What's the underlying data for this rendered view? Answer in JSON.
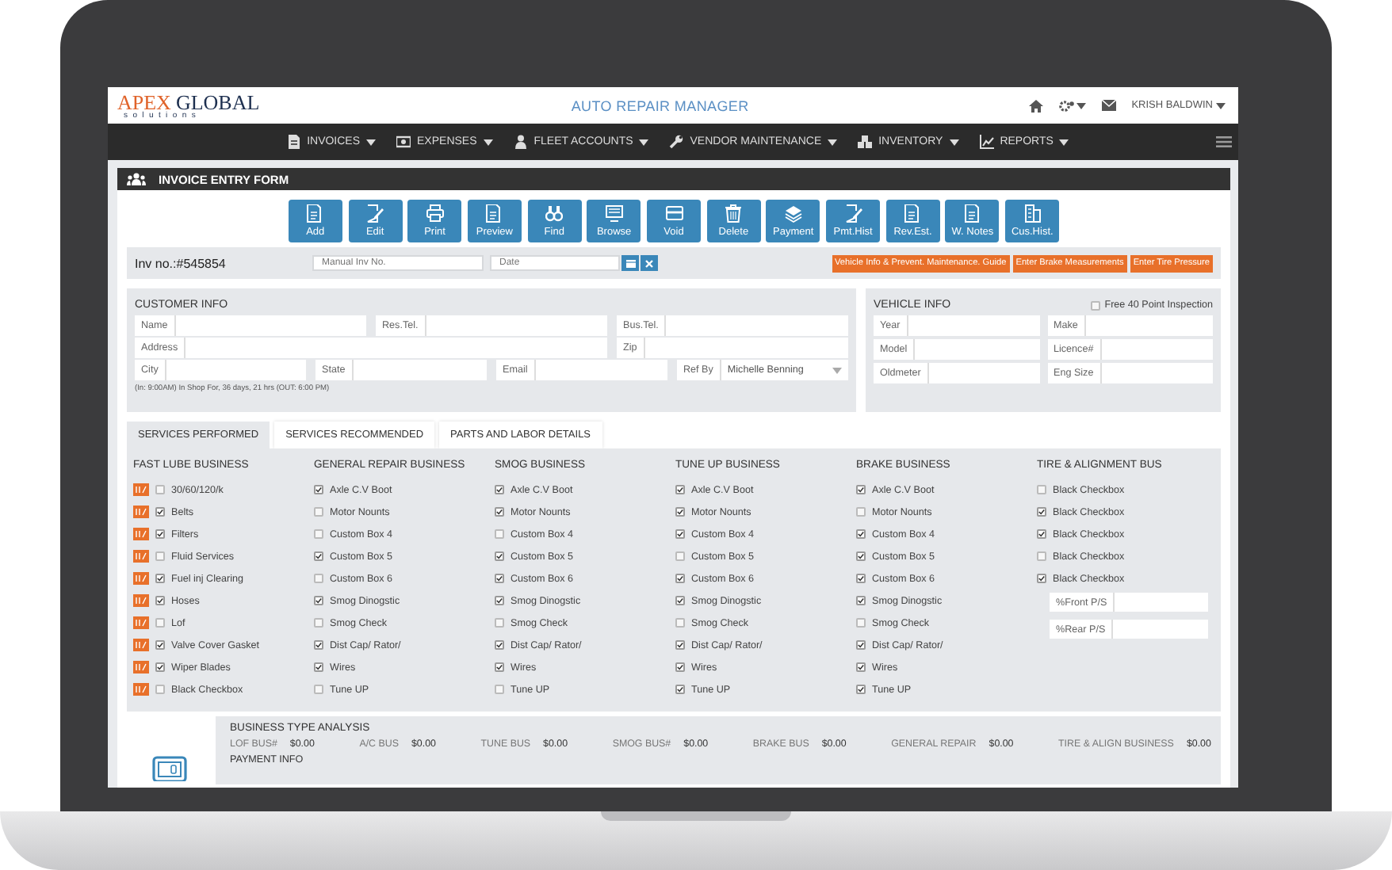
{
  "header": {
    "logo": {
      "brand": "APEX",
      "name": "GLOBAL",
      "tagline": "solutions"
    },
    "title": "AUTO REPAIR MANAGER",
    "user": "KRISH BALDWIN"
  },
  "nav": [
    {
      "label": "INVOICES"
    },
    {
      "label": "EXPENSES"
    },
    {
      "label": "FLEET ACCOUNTS"
    },
    {
      "label": "VENDOR MAINTENANCE"
    },
    {
      "label": "INVENTORY"
    },
    {
      "label": "REPORTS"
    }
  ],
  "form_title": "INVOICE ENTRY FORM",
  "toolbar": [
    {
      "label": "Add"
    },
    {
      "label": "Edit"
    },
    {
      "label": "Print"
    },
    {
      "label": "Preview"
    },
    {
      "label": "Find"
    },
    {
      "label": "Browse"
    },
    {
      "label": "Void"
    },
    {
      "label": "Delete"
    },
    {
      "label": "Payment"
    },
    {
      "label": "Pmt.Hist"
    },
    {
      "label": "Rev.Est."
    },
    {
      "label": "W. Notes"
    },
    {
      "label": "Cus.Hist."
    }
  ],
  "invoice": {
    "number": "Inv no.:#545854",
    "manual_placeholder": "Manual Inv No.",
    "date_placeholder": "Date"
  },
  "guide_buttons": [
    "Vehicle Info & Prevent. Maintenance. Guide",
    "Enter Brake Measurements",
    "Enter Tire Pressure"
  ],
  "customer_info": {
    "title": "CUSTOMER INFO",
    "rows": [
      [
        {
          "label": "Name",
          "kind": "text"
        },
        {
          "label": "Res.Tel.",
          "kind": "text"
        },
        {
          "label": "Bus.Tel.",
          "kind": "text"
        }
      ],
      [
        {
          "label": "Address",
          "kind": "text"
        },
        {
          "label": "Zip",
          "kind": "text"
        }
      ],
      [
        {
          "label": "City",
          "kind": "text"
        },
        {
          "label": "State",
          "kind": "text"
        },
        {
          "label": "Email",
          "kind": "text"
        },
        {
          "label": "Ref By",
          "kind": "select",
          "value": "Michelle Benning"
        }
      ]
    ],
    "note": "(In: 9:00AM) In Shop For, 36 days, 21 hrs (OUT: 6:00 PM)"
  },
  "vehicle_info": {
    "title": "VEHICLE INFO",
    "free_inspection": {
      "label": "Free 40 Point Inspection",
      "checked": false
    },
    "fields": [
      {
        "label": "Year"
      },
      {
        "label": "Make"
      },
      {
        "label": "Model"
      },
      {
        "label": "Licence#"
      },
      {
        "label": "Oldmeter"
      },
      {
        "label": "Eng Size"
      }
    ]
  },
  "tabs": [
    {
      "label": "SERVICES PERFORMED",
      "selected": true
    },
    {
      "label": "SERVICES RECOMMENDED",
      "selected": false
    },
    {
      "label": "PARTS AND LABOR DETAILS",
      "selected": false
    }
  ],
  "services": [
    {
      "title": "FAST LUBE BUSINESS",
      "tagged": true,
      "items": [
        {
          "label": "30/60/120/k",
          "checked": false
        },
        {
          "label": "Belts",
          "checked": true
        },
        {
          "label": "Filters",
          "checked": true
        },
        {
          "label": "Fluid Services",
          "checked": false
        },
        {
          "label": "Fuel inj Clearing",
          "checked": true
        },
        {
          "label": "Hoses",
          "checked": true
        },
        {
          "label": "Lof",
          "checked": false
        },
        {
          "label": "Valve Cover Gasket",
          "checked": true
        },
        {
          "label": "Wiper Blades",
          "checked": true
        },
        {
          "label": "Black Checkbox",
          "checked": false
        }
      ]
    },
    {
      "title": "GENERAL REPAIR BUSINESS",
      "tagged": false,
      "items": [
        {
          "label": "Axle C.V Boot",
          "checked": true
        },
        {
          "label": "Motor Nounts",
          "checked": false
        },
        {
          "label": "Custom Box 4",
          "checked": false
        },
        {
          "label": "Custom Box 5",
          "checked": true
        },
        {
          "label": "Custom Box 6",
          "checked": false
        },
        {
          "label": "Smog Dinogstic",
          "checked": true
        },
        {
          "label": "Smog Check",
          "checked": false
        },
        {
          "label": "Dist Cap/ Rator/",
          "checked": true
        },
        {
          "label": "Wires",
          "checked": true
        },
        {
          "label": "Tune UP",
          "checked": false
        }
      ]
    },
    {
      "title": "SMOG BUSINESS",
      "tagged": false,
      "items": [
        {
          "label": "Axle C.V Boot",
          "checked": true
        },
        {
          "label": "Motor Nounts",
          "checked": true
        },
        {
          "label": "Custom Box 4",
          "checked": false
        },
        {
          "label": "Custom Box 5",
          "checked": true
        },
        {
          "label": "Custom Box 6",
          "checked": true
        },
        {
          "label": "Smog Dinogstic",
          "checked": true
        },
        {
          "label": "Smog Check",
          "checked": false
        },
        {
          "label": "Dist Cap/ Rator/",
          "checked": true
        },
        {
          "label": "Wires",
          "checked": true
        },
        {
          "label": "Tune UP",
          "checked": false
        }
      ]
    },
    {
      "title": "TUNE UP BUSINESS",
      "tagged": false,
      "items": [
        {
          "label": "Axle C.V Boot",
          "checked": true
        },
        {
          "label": "Motor Nounts",
          "checked": true
        },
        {
          "label": "Custom Box 4",
          "checked": true
        },
        {
          "label": "Custom Box 5",
          "checked": false
        },
        {
          "label": "Custom Box 6",
          "checked": true
        },
        {
          "label": "Smog Dinogstic",
          "checked": true
        },
        {
          "label": "Smog Check",
          "checked": false
        },
        {
          "label": "Dist Cap/ Rator/",
          "checked": true
        },
        {
          "label": "Wires",
          "checked": true
        },
        {
          "label": "Tune UP",
          "checked": true
        }
      ]
    },
    {
      "title": "BRAKE BUSINESS",
      "tagged": false,
      "items": [
        {
          "label": "Axle C.V Boot",
          "checked": true
        },
        {
          "label": "Motor Nounts",
          "checked": false
        },
        {
          "label": "Custom Box 4",
          "checked": true
        },
        {
          "label": "Custom Box 5",
          "checked": true
        },
        {
          "label": "Custom Box 6",
          "checked": true
        },
        {
          "label": "Smog Dinogstic",
          "checked": true
        },
        {
          "label": "Smog Check",
          "checked": false
        },
        {
          "label": "Dist Cap/ Rator/",
          "checked": true
        },
        {
          "label": "Wires",
          "checked": true
        },
        {
          "label": "Tune UP",
          "checked": true
        }
      ]
    },
    {
      "title": "TIRE & ALIGNMENT BUS",
      "tagged": false,
      "items": [
        {
          "label": "Black Checkbox",
          "checked": false
        },
        {
          "label": "Black Checkbox",
          "checked": true
        },
        {
          "label": "Black Checkbox",
          "checked": true
        },
        {
          "label": "Black Checkbox",
          "checked": false
        },
        {
          "label": "Black Checkbox",
          "checked": true
        }
      ],
      "fields": [
        {
          "label": "%Front P/S"
        },
        {
          "label": "%Rear P/S"
        }
      ]
    }
  ],
  "analysis": {
    "title": "BUSINESS TYPE ANALYSIS",
    "items": [
      {
        "label": "LOF BUS#",
        "value": "$0.00"
      },
      {
        "label": "A/C BUS",
        "value": "$0.00"
      },
      {
        "label": "TUNE BUS",
        "value": "$0.00"
      },
      {
        "label": "SMOG BUS#",
        "value": "$0.00"
      },
      {
        "label": "BRAKE BUS",
        "value": "$0.00"
      },
      {
        "label": "GENERAL REPAIR",
        "value": "$0.00"
      },
      {
        "label": "TIRE & ALIGN BUSINESS",
        "value": "$0.00"
      }
    ],
    "payment_title": "PAYMENT INFO"
  }
}
